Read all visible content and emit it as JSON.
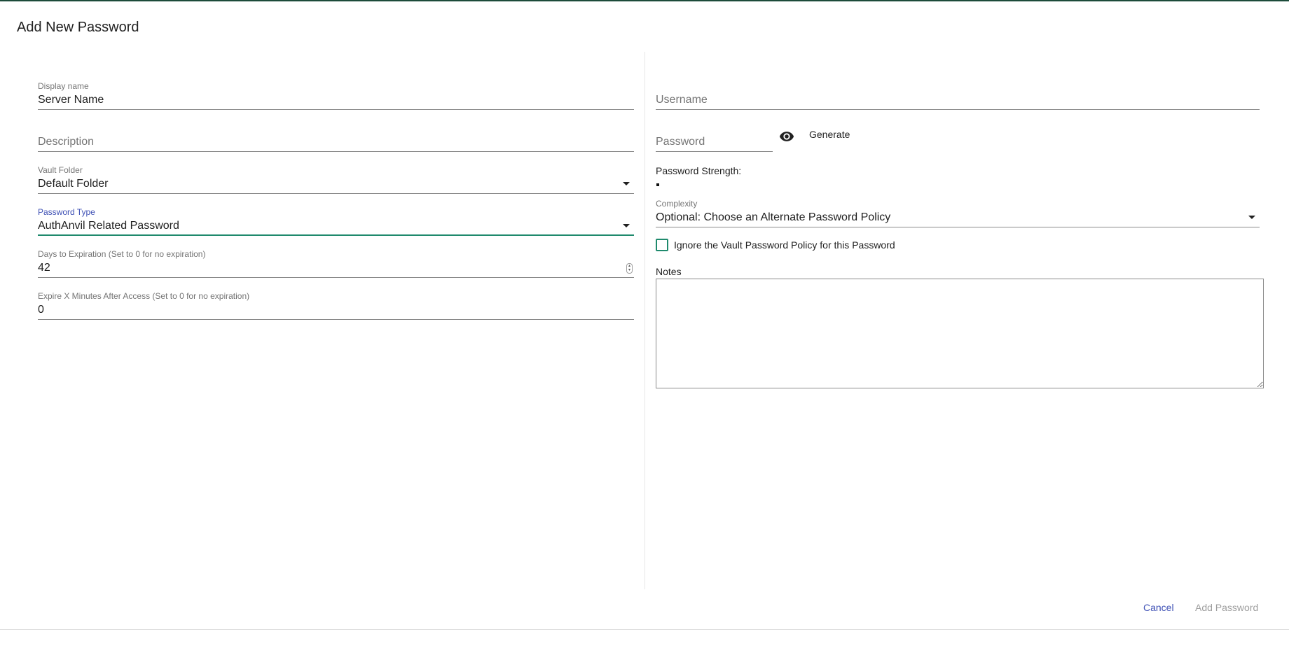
{
  "dialog": {
    "title": "Add New Password"
  },
  "left": {
    "display_name": {
      "label": "Display name",
      "value": "Server Name"
    },
    "description": {
      "placeholder": "Description"
    },
    "vault_folder": {
      "label": "Vault Folder",
      "value": "Default Folder"
    },
    "password_type": {
      "label": "Password Type",
      "value": "AuthAnvil Related Password"
    },
    "days_expiration": {
      "label": "Days to Expiration (Set to 0 for no expiration)",
      "value": "42"
    },
    "expire_minutes": {
      "label": "Expire X Minutes After Access (Set to 0 for no expiration)",
      "value": "0"
    }
  },
  "right": {
    "username": {
      "placeholder": "Username"
    },
    "password": {
      "placeholder": "Password"
    },
    "generate_label": "Generate",
    "strength_label": "Password Strength:",
    "complexity": {
      "label": "Complexity",
      "value": "Optional: Choose an Alternate Password Policy"
    },
    "ignore_policy_label": "Ignore the Vault Password Policy for this Password",
    "notes_label": "Notes"
  },
  "actions": {
    "cancel": "Cancel",
    "add": "Add Password"
  },
  "colors": {
    "accent": "#1f8a6d",
    "primary": "#3f51b5",
    "disabled": "#9e9e9e"
  }
}
